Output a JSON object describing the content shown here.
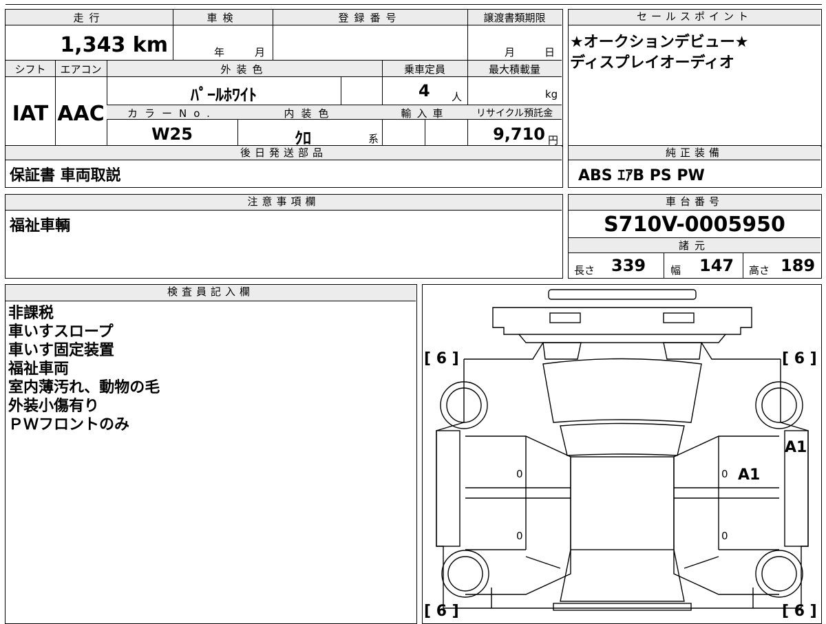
{
  "top": {
    "mileage_header": "走行",
    "shaken_header": "車検",
    "reg_header": "登録番号",
    "transfer_header": "譲渡書類期限",
    "sales_header": "セールスポイント",
    "mileage_value": "1,343",
    "mileage_unit": "km",
    "shaken_year": "年",
    "shaken_month": "月",
    "transfer_month": "月",
    "transfer_day": "日"
  },
  "sales_points": [
    "★オークションデビュー★",
    "ディスプレイオーディオ"
  ],
  "row2": {
    "shift_header": "シフト",
    "aircon_header": "エアコン",
    "exterior_header": "外装色",
    "capacity_header": "乗車定員",
    "maxload_header": "最大積載量",
    "shift_value": "IAT",
    "aircon_value": "AAC",
    "exterior_value": "ﾊﾟｰﾙﾎﾜｲﾄ",
    "capacity_value": "4",
    "capacity_unit": "人",
    "maxload_unit": "kg",
    "color_no_header": "カラーNo.",
    "interior_header": "内装色",
    "import_header": "輸入車",
    "recycle_header": "リサイクル預託金",
    "color_no_value": "W25",
    "interior_value": "ｸﾛ",
    "interior_suffix": "系",
    "recycle_value": "9,710",
    "recycle_unit": "円"
  },
  "later_parts": {
    "header": "後日発送部品",
    "value": "保証書 車両取説"
  },
  "equipment": {
    "header": "純正装備",
    "value": "ABS ｴｱB PS PW"
  },
  "caution": {
    "header": "注意事項欄",
    "value": "福祉車輌"
  },
  "chassis": {
    "header": "車台番号",
    "value": "S710V-0005950"
  },
  "specs": {
    "header": "諸元",
    "length_label": "長さ",
    "length_value": "339",
    "width_label": "幅",
    "width_value": "147",
    "height_label": "高さ",
    "height_value": "189"
  },
  "inspector": {
    "header": "検査員記入欄",
    "notes": [
      "非課税",
      "車いすスロープ",
      "車いす固定装置",
      "福祉車両",
      "室内薄汚れ、動物の毛",
      "外装小傷有り",
      "ＰＷフロントのみ"
    ]
  },
  "diagram": {
    "tread": [
      "[ 6 ]",
      "[ 6 ]",
      "[ 6 ]",
      "[ 6 ]"
    ],
    "marks": {
      "right_rear_door": "A1",
      "right_slide": "A1"
    },
    "door_zeros": [
      "0",
      "0",
      "0",
      "0"
    ]
  }
}
